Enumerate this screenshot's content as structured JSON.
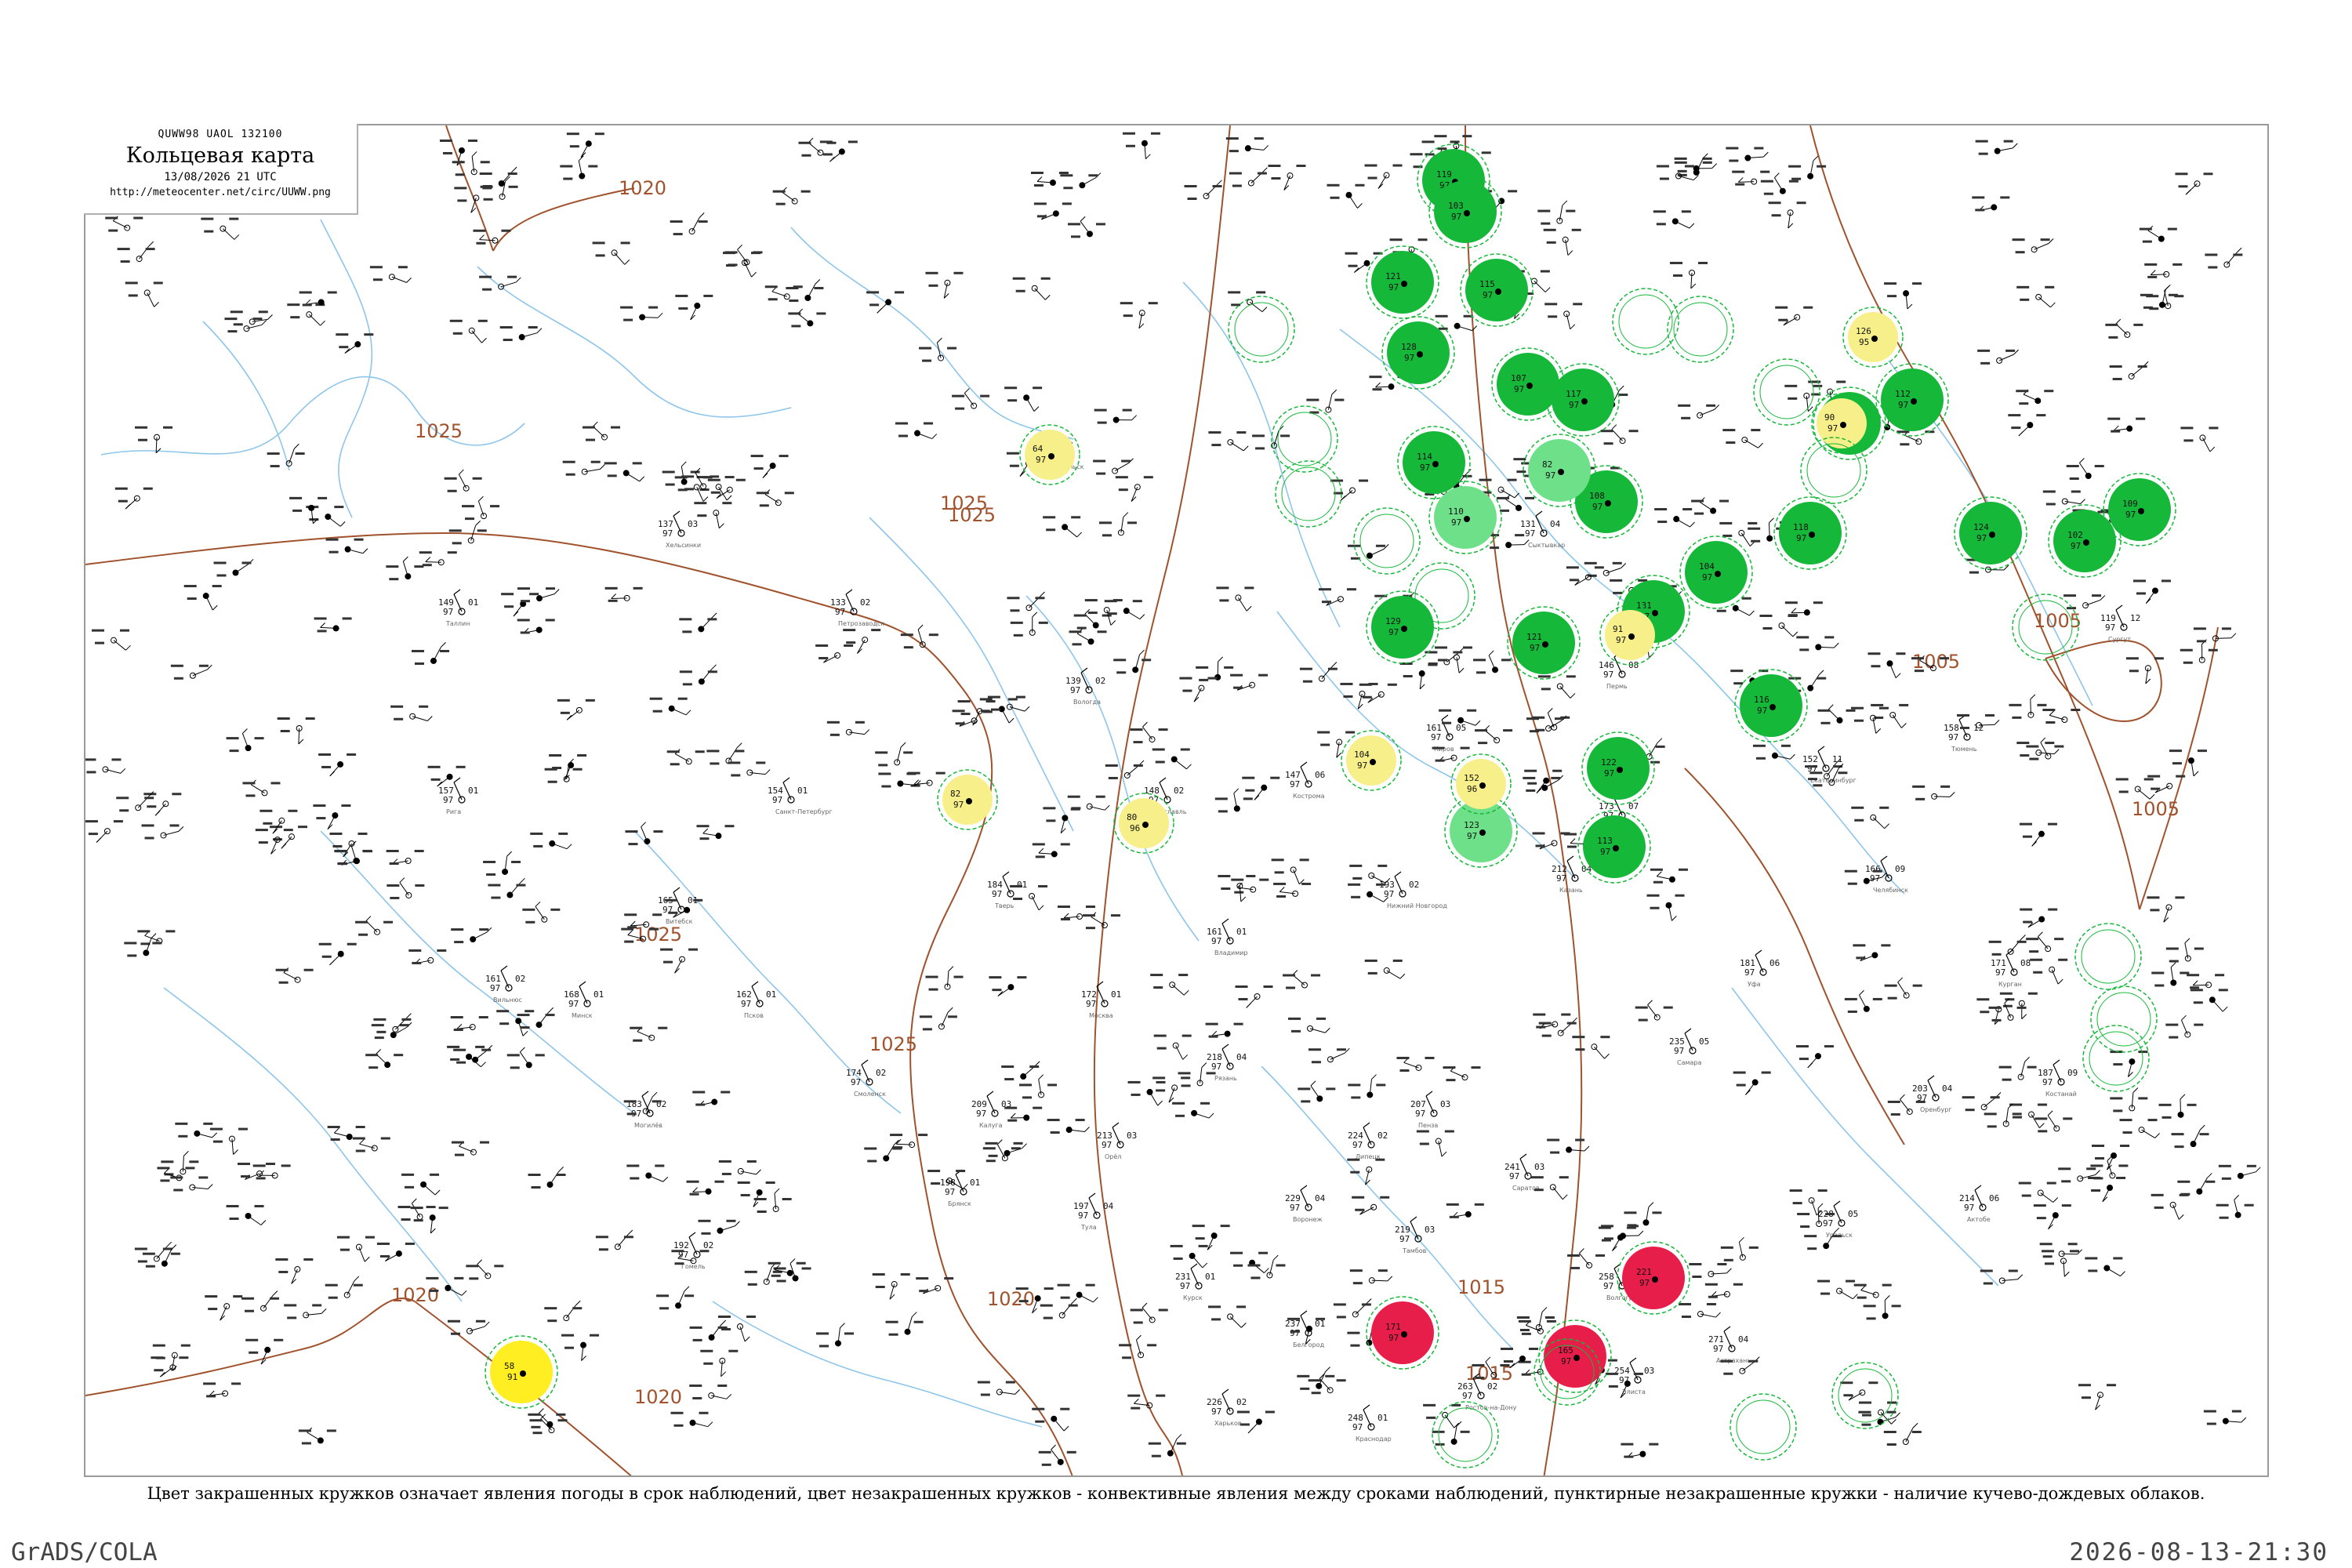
{
  "header": {
    "code_line": "QUWW98  UAOL  132100",
    "title": "Кольцевая карта",
    "date_line": "13/08/2026 21 UTC",
    "url": "http://meteocenter.net/circ/UUWW.png"
  },
  "caption": "Цвет закрашенных кружков означает явления погоды в срок наблюдений, цвет незакрашенных кружков - конвективные явления между сроками наблюдений, пунктирные незакрашенные кружки - наличие кучево-дождевых облаков.",
  "footer": {
    "left": "GrADS/COLA",
    "right": "2026-08-13-21:30"
  },
  "colors": {
    "isobar": "#a0522d",
    "river": "#8ec5ea",
    "thunderstorm_fill": "#16b83a",
    "shower_fill": "#6fe08a",
    "dust_fill": "#f7f08a",
    "fog_fill": "#ffee22",
    "hail_fill": "#e81e4a",
    "cb_dashed": "#16b83a",
    "frame": "#9a9a9a"
  },
  "isobar_labels": [
    "1020",
    "1025",
    "1025",
    "1025",
    "1020",
    "1020",
    "1020",
    "1015",
    "1015",
    "1005",
    "1005",
    "1005",
    "1025",
    "1025"
  ],
  "stations": [
    {
      "name": "Москва",
      "temp": "172",
      "dew": "97",
      "pres": "01"
    },
    {
      "name": "Рязань",
      "temp": "218",
      "dew": "97",
      "pres": "04"
    },
    {
      "name": "Тверь",
      "temp": "184",
      "dew": "97",
      "pres": "01"
    },
    {
      "name": "Калуга",
      "temp": "209",
      "dew": "97",
      "pres": "03"
    },
    {
      "name": "Тула",
      "temp": "197",
      "dew": "97",
      "pres": "04"
    },
    {
      "name": "Владимир",
      "temp": "161",
      "dew": "97",
      "pres": "01"
    },
    {
      "name": "Ярославль",
      "temp": "148",
      "dew": "97",
      "pres": "02"
    },
    {
      "name": "Кострома",
      "temp": "147",
      "dew": "97",
      "pres": "06"
    },
    {
      "name": "Нижний Новгород",
      "temp": "193",
      "dew": "97",
      "pres": "02"
    },
    {
      "name": "Казань",
      "temp": "212",
      "dew": "97",
      "pres": "04"
    },
    {
      "name": "Самара",
      "temp": "235",
      "dew": "97",
      "pres": "05"
    },
    {
      "name": "Саратов",
      "temp": "241",
      "dew": "97",
      "pres": "03"
    },
    {
      "name": "Волгоград",
      "temp": "258",
      "dew": "97",
      "pres": "02"
    },
    {
      "name": "Воронеж",
      "temp": "229",
      "dew": "97",
      "pres": "04"
    },
    {
      "name": "Курск",
      "temp": "231",
      "dew": "97",
      "pres": "01"
    },
    {
      "name": "Орёл",
      "temp": "213",
      "dew": "97",
      "pres": "03"
    },
    {
      "name": "Брянск",
      "temp": "198",
      "dew": "97",
      "pres": "01"
    },
    {
      "name": "Смоленск",
      "temp": "174",
      "dew": "97",
      "pres": "02"
    },
    {
      "name": "Псков",
      "temp": "162",
      "dew": "97",
      "pres": "01"
    },
    {
      "name": "Санкт-Петербург",
      "temp": "154",
      "dew": "97",
      "pres": "01"
    },
    {
      "name": "Петрозаводск",
      "temp": "133",
      "dew": "97",
      "pres": "02"
    },
    {
      "name": "Архангельск",
      "temp": "112",
      "dew": "97",
      "pres": "01"
    },
    {
      "name": "Вологда",
      "temp": "139",
      "dew": "97",
      "pres": "02"
    },
    {
      "name": "Киров",
      "temp": "161",
      "dew": "97",
      "pres": "05"
    },
    {
      "name": "Пермь",
      "temp": "146",
      "dew": "97",
      "pres": "08"
    },
    {
      "name": "Екатеринбург",
      "temp": "152",
      "dew": "97",
      "pres": "11"
    },
    {
      "name": "Уфа",
      "temp": "181",
      "dew": "97",
      "pres": "06"
    },
    {
      "name": "Оренбург",
      "temp": "203",
      "dew": "97",
      "pres": "04"
    },
    {
      "name": "Челябинск",
      "temp": "166",
      "dew": "97",
      "pres": "09"
    },
    {
      "name": "Тюмень",
      "temp": "158",
      "dew": "97",
      "pres": "12"
    },
    {
      "name": "Сыктывкар",
      "temp": "131",
      "dew": "97",
      "pres": "04"
    },
    {
      "name": "Ижевск",
      "temp": "173",
      "dew": "97",
      "pres": "07"
    },
    {
      "name": "Пенза",
      "temp": "207",
      "dew": "97",
      "pres": "03"
    },
    {
      "name": "Липецк",
      "temp": "224",
      "dew": "97",
      "pres": "02"
    },
    {
      "name": "Тамбов",
      "temp": "219",
      "dew": "97",
      "pres": "03"
    },
    {
      "name": "Белгород",
      "temp": "237",
      "dew": "97",
      "pres": "01"
    },
    {
      "name": "Ростов-на-Дону",
      "temp": "263",
      "dew": "97",
      "pres": "02"
    },
    {
      "name": "Астрахань",
      "temp": "271",
      "dew": "97",
      "pres": "04"
    },
    {
      "name": "Элиста",
      "temp": "254",
      "dew": "97",
      "pres": "03"
    },
    {
      "name": "Краснодар",
      "temp": "248",
      "dew": "97",
      "pres": "01"
    },
    {
      "name": "Минск",
      "temp": "168",
      "dew": "97",
      "pres": "01"
    },
    {
      "name": "Гомель",
      "temp": "192",
      "dew": "97",
      "pres": "02"
    },
    {
      "name": "Витебск",
      "temp": "165",
      "dew": "97",
      "pres": "01"
    },
    {
      "name": "Могилёв",
      "temp": "183",
      "dew": "97",
      "pres": "02"
    },
    {
      "name": "Киев",
      "temp": "215",
      "dew": "97",
      "pres": "01"
    },
    {
      "name": "Харьков",
      "temp": "226",
      "dew": "97",
      "pres": "02"
    },
    {
      "name": "Рига",
      "temp": "157",
      "dew": "97",
      "pres": "01"
    },
    {
      "name": "Вильнюс",
      "temp": "161",
      "dew": "97",
      "pres": "02"
    },
    {
      "name": "Таллин",
      "temp": "149",
      "dew": "97",
      "pres": "01"
    },
    {
      "name": "Хельсинки",
      "temp": "137",
      "dew": "97",
      "pres": "03"
    },
    {
      "name": "Уральск",
      "temp": "228",
      "dew": "97",
      "pres": "05"
    },
    {
      "name": "Актобе",
      "temp": "214",
      "dew": "97",
      "pres": "06"
    },
    {
      "name": "Костанай",
      "temp": "187",
      "dew": "97",
      "pres": "09"
    },
    {
      "name": "Курган",
      "temp": "171",
      "dew": "97",
      "pres": "08"
    },
    {
      "name": "Сургут",
      "temp": "119",
      "dew": "97",
      "pres": "12"
    }
  ],
  "weather_circles": [
    {
      "kind": "thunderstorm",
      "label_temp": "119",
      "label_dew": "97"
    },
    {
      "kind": "thunderstorm",
      "label_temp": "103",
      "label_dew": "97"
    },
    {
      "kind": "thunderstorm",
      "label_temp": "121",
      "label_dew": "97"
    },
    {
      "kind": "thunderstorm",
      "label_temp": "128",
      "label_dew": "97"
    },
    {
      "kind": "thunderstorm",
      "label_temp": "115",
      "label_dew": "97"
    },
    {
      "kind": "thunderstorm",
      "label_temp": "114",
      "label_dew": "97"
    },
    {
      "kind": "thunderstorm",
      "label_temp": "107",
      "label_dew": "97"
    },
    {
      "kind": "thunderstorm",
      "label_temp": "121",
      "label_dew": "97"
    },
    {
      "kind": "thunderstorm",
      "label_temp": "129",
      "label_dew": "97"
    },
    {
      "kind": "thunderstorm",
      "label_temp": "113",
      "label_dew": "97"
    },
    {
      "kind": "thunderstorm",
      "label_temp": "117",
      "label_dew": "97"
    },
    {
      "kind": "thunderstorm",
      "label_temp": "131",
      "label_dew": "97"
    },
    {
      "kind": "thunderstorm",
      "label_temp": "108",
      "label_dew": "97"
    },
    {
      "kind": "thunderstorm",
      "label_temp": "104",
      "label_dew": "97"
    },
    {
      "kind": "thunderstorm",
      "label_temp": "116",
      "label_dew": "97"
    },
    {
      "kind": "thunderstorm",
      "label_temp": "122",
      "label_dew": "97"
    },
    {
      "kind": "thunderstorm",
      "label_temp": "126",
      "label_dew": "97"
    },
    {
      "kind": "thunderstorm",
      "label_temp": "112",
      "label_dew": "97"
    },
    {
      "kind": "thunderstorm",
      "label_temp": "118",
      "label_dew": "97"
    },
    {
      "kind": "thunderstorm",
      "label_temp": "124",
      "label_dew": "97"
    },
    {
      "kind": "thunderstorm",
      "label_temp": "102",
      "label_dew": "97"
    },
    {
      "kind": "thunderstorm",
      "label_temp": "109",
      "label_dew": "97"
    },
    {
      "kind": "shower",
      "label_temp": "110",
      "label_dew": "97"
    },
    {
      "kind": "shower",
      "label_temp": "82",
      "label_dew": "97"
    },
    {
      "kind": "shower",
      "label_temp": "123",
      "label_dew": "97"
    },
    {
      "kind": "dust",
      "label_temp": "64",
      "label_dew": "97"
    },
    {
      "kind": "dust",
      "label_temp": "82",
      "label_dew": "97"
    },
    {
      "kind": "dust",
      "label_temp": "80",
      "label_dew": "96"
    },
    {
      "kind": "dust",
      "label_temp": "104",
      "label_dew": "97"
    },
    {
      "kind": "dust",
      "label_temp": "152",
      "label_dew": "96"
    },
    {
      "kind": "dust",
      "label_temp": "91",
      "label_dew": "97"
    },
    {
      "kind": "dust",
      "label_temp": "90",
      "label_dew": "97"
    },
    {
      "kind": "dust",
      "label_temp": "126",
      "label_dew": "95"
    },
    {
      "kind": "fog",
      "label_temp": "58",
      "label_dew": "91"
    },
    {
      "kind": "hail",
      "label_temp": "171",
      "label_dew": "97"
    },
    {
      "kind": "hail",
      "label_temp": "165",
      "label_dew": "97"
    },
    {
      "kind": "hail",
      "label_temp": "221",
      "label_dew": "97"
    }
  ]
}
